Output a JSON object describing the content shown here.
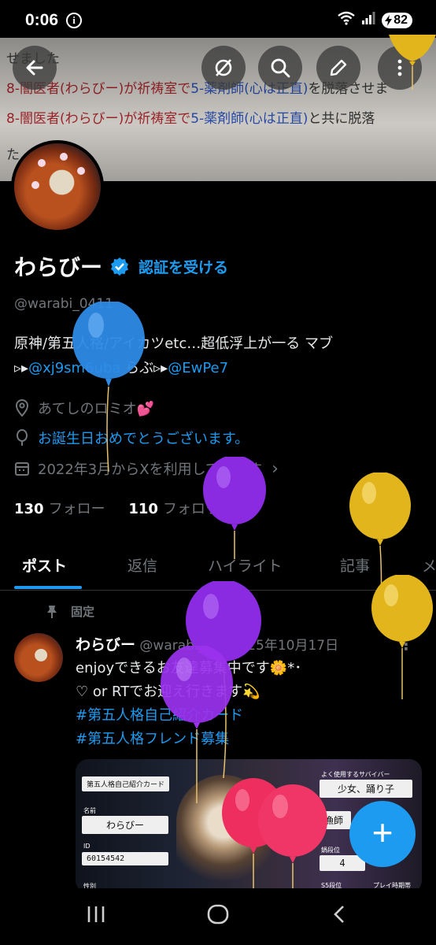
{
  "status_bar": {
    "time": "0:06",
    "info_glyph": "i",
    "battery": "82"
  },
  "banner": {
    "line1": "せました",
    "line2a": "8-闇医者(わらびー)が祈祷室で",
    "line2b": "5-薬剤師(心は正直)",
    "line2c": "を脱落させま",
    "line3a": "8-闇医者(わらびー)が祈祷室で",
    "line3b": "5-薬剤師(心は正直)",
    "line3c": "と共に脱落",
    "line4": "た"
  },
  "header_icons": [
    "back-arrow-icon",
    "grok-icon",
    "search-icon",
    "edit-icon",
    "more-icon"
  ],
  "profile": {
    "name": "わらびー",
    "get_verified": "認証を受ける",
    "handle": "@warabi_0411",
    "bio_line1": "原神/第五人格/アイカツetc…超低浮上が一る マブ",
    "bio_line2_prefix": "▹▸",
    "bio_link1": "@xj9sm6uba",
    "bio_mid": " らぶ▹▸",
    "bio_link2": "@EwPe7",
    "location": "あてしのロミオ💕",
    "birthday": "お誕生日おめでとうございます。",
    "joined": "2022年3月からXを利用しています",
    "joined_chevron": "›",
    "following_count": "130",
    "following_label": "フォロー",
    "followers_count": "110",
    "followers_label": "フォロワー"
  },
  "tabs": [
    {
      "label": "ポスト",
      "active": true
    },
    {
      "label": "返信",
      "active": false
    },
    {
      "label": "ハイライト",
      "active": false
    },
    {
      "label": "記事",
      "active": false
    },
    {
      "label": "メ",
      "active": false
    }
  ],
  "post": {
    "pinned_label": "固定",
    "author": "わらびー",
    "handle_date": "@warabi_... · 2025年10月17日",
    "more": "⋮",
    "line1": "enjoyできるお友達募集中です🌼*･",
    "line2": "♡ or RTでお迎え行きます💫",
    "hashtag1": "#第五人格自己紹介カード",
    "hashtag2": "#第五人格フレンド募集"
  },
  "card": {
    "title": "第五人格自己紹介カード",
    "name_label": "名前",
    "name_value": "わらびー",
    "id_label": "ID",
    "id_value": "60154542",
    "gender_label": "性別",
    "hunter_label": "よく使用するサバイバー",
    "survivor_value": "少女、踊り子",
    "hunter_value": "漁師",
    "rank_label": "鍋段位",
    "rank_value": "4",
    "ss_label": "S5段位",
    "play_label": "プレイ時期帯"
  },
  "fab_label": "+",
  "nav": {
    "recents": "|||",
    "home": "○",
    "back": "‹"
  },
  "colors": {
    "accent": "#1d9bf0",
    "background": "#000000",
    "muted": "#71767b"
  },
  "balloons": [
    {
      "color": "#2e8be6",
      "name": "blue-balloon"
    },
    {
      "color": "#8a2be2",
      "name": "purple-balloon"
    },
    {
      "color": "#e3b51c",
      "name": "yellow-balloon"
    },
    {
      "color": "#ee2e5e",
      "name": "red-balloon"
    }
  ]
}
